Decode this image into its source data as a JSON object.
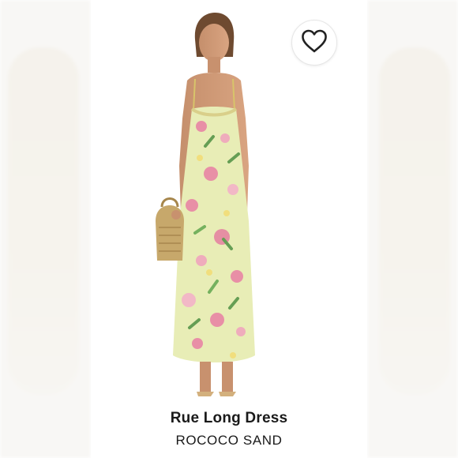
{
  "product": {
    "name": "Rue Long Dress",
    "brand": "ROCOCO SAND",
    "image_alt": "Model wearing a pale yellow floral print maxi slip dress holding a woven straw bag"
  },
  "favorite": {
    "icon": "heart-outline-icon",
    "selected": false
  },
  "colors": {
    "background": "#ffffff",
    "dress_base": "#e8edb6",
    "floral_pink": "#e88aa6",
    "floral_green": "#5f9a4f",
    "text": "#1a1a1a"
  }
}
